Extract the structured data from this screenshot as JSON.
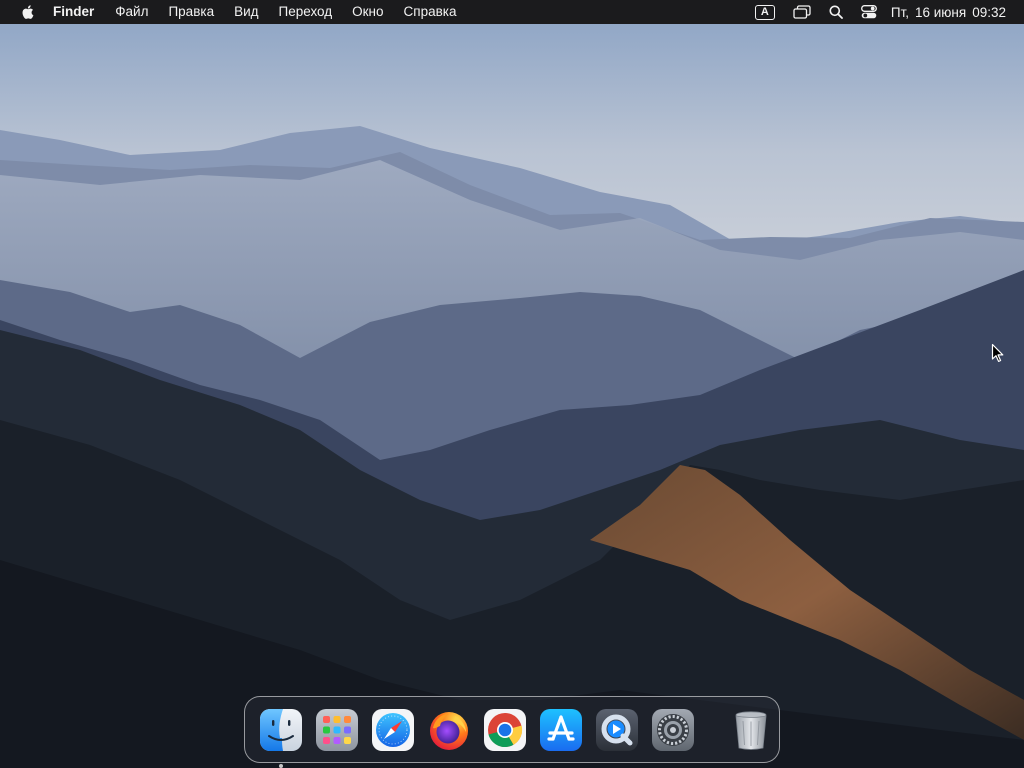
{
  "menubar": {
    "apple_icon": "apple-logo-icon",
    "app_name": "Finder",
    "items": [
      "Файл",
      "Правка",
      "Вид",
      "Переход",
      "Окно",
      "Справка"
    ],
    "status": {
      "input_source_label": "A",
      "icons": [
        "keyboard-input-icon",
        "window-mirror-icon",
        "search-icon",
        "control-center-icon"
      ],
      "day": "Пт,",
      "date": "16 июня",
      "time": "09:32"
    }
  },
  "dock": {
    "apps": [
      {
        "name": "Finder",
        "icon": "finder-icon",
        "running": true
      },
      {
        "name": "Launchpad",
        "icon": "launchpad-icon",
        "running": false
      },
      {
        "name": "Safari",
        "icon": "safari-icon",
        "running": false
      },
      {
        "name": "Firefox",
        "icon": "firefox-icon",
        "running": false
      },
      {
        "name": "Google Chrome",
        "icon": "chrome-icon",
        "running": false
      },
      {
        "name": "App Store",
        "icon": "app-store-icon",
        "running": false
      },
      {
        "name": "QuickTime Player",
        "icon": "quicktime-icon",
        "running": false
      },
      {
        "name": "System Settings",
        "icon": "system-settings-icon",
        "running": false
      }
    ],
    "trash": {
      "name": "Trash",
      "icon": "trash-icon"
    }
  },
  "wallpaper": {
    "subject": "mountain-ranges-in-morning-haze"
  },
  "colors": {
    "menubar_bg": "#1b1b1d",
    "menubar_text": "#f2f2f2",
    "dock_border": "#ffffff"
  }
}
